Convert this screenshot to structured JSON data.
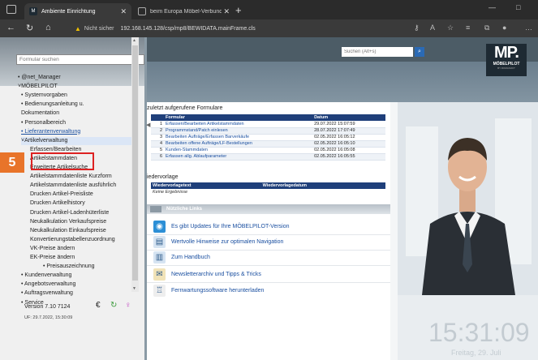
{
  "browser": {
    "tabs": [
      {
        "title": "Ambiente Einrichtung",
        "active": true
      },
      {
        "title": "beim Europa Möbel-Verbund - ",
        "active": false
      }
    ],
    "address": {
      "security_label": "Nicht sicher",
      "url": "192.168.145.128/csp/mp8/BEWIDATA.mainFrame.cls"
    }
  },
  "sidebar": {
    "search_placeholder": "Formular suchen",
    "tree": [
      {
        "label": "• @net_Manager",
        "indent": 0
      },
      {
        "label": "˅MÖBELPILOT",
        "indent": 0
      },
      {
        "label": "• Systemvorgaben",
        "indent": 1
      },
      {
        "label": "• Bedienungsanleitung u.",
        "indent": 1
      },
      {
        "label": "Dokumentation",
        "indent": 1
      },
      {
        "label": "• Personalbereich",
        "indent": 1
      },
      {
        "label": "• Lieferantenverwaltung",
        "indent": 1,
        "link": true
      },
      {
        "label": "˅Artikelverwaltung",
        "indent": 1,
        "highlight": true
      },
      {
        "label": "Erfassen/Bearbeiten",
        "indent": 2
      },
      {
        "label": "Artikelstammdaten",
        "indent": 2
      },
      {
        "label": "Erweiterte Artikelsuche",
        "indent": 2
      },
      {
        "label": "Artikelstammdatenliste Kurzform",
        "indent": 2
      },
      {
        "label": "Artikelstammdatenliste ausführlich",
        "indent": 2
      },
      {
        "label": "Drucken Artikel-Preisliste",
        "indent": 2
      },
      {
        "label": "Drucken Artikelhistory",
        "indent": 2
      },
      {
        "label": "Drucken Artikel-Ladenhüterliste",
        "indent": 2
      },
      {
        "label": "Neukalkulation Verkaufspreise",
        "indent": 2
      },
      {
        "label": "Neukalkulation Einkaufspreise",
        "indent": 2
      },
      {
        "label": "Konvertierungstabellenzuordnung",
        "indent": 2
      },
      {
        "label": "VK-Preise ändern",
        "indent": 2
      },
      {
        "label": "EK-Preise ändern",
        "indent": 2
      },
      {
        "label": "• Preisauszeichnung",
        "indent": 3
      },
      {
        "label": "• Kundenverwaltung",
        "indent": 1
      },
      {
        "label": "• Angebotsverwaltung",
        "indent": 1
      },
      {
        "label": "• Auftragsverwaltung",
        "indent": 1
      },
      {
        "label": "• Service",
        "indent": 1
      }
    ],
    "version": "Version 7.10 7124",
    "uf_timestamp": "UF: 29.7.2022, 15:30:09"
  },
  "annotation": {
    "step_number": "5"
  },
  "header": {
    "search_placeholder": "Suchen (Alt+s)",
    "logo_text": "MP.",
    "logo_name": "MÖBELPILOT",
    "logo_sub": "BY ROMASOFT"
  },
  "recent": {
    "title": "zuletzt aufgerufene Formulare",
    "columns": [
      "Formular",
      "Datum"
    ],
    "rows": [
      {
        "num": "1",
        "formular": "Erfassen/Bearbeiten Artikelstammdaten",
        "datum": "29.07.2022 15:07:59"
      },
      {
        "num": "2",
        "formular": "Programmstand/Patch einlesen",
        "datum": "28.07.2022 17:07:49"
      },
      {
        "num": "3",
        "formular": "Bearbeiten Aufträge/Erfassen Barverkäufe",
        "datum": "02.05.2022 16:05:12"
      },
      {
        "num": "4",
        "formular": "Bearbeiten offene Aufträge/LF-Bestellungen",
        "datum": "02.05.2022 16:05:10"
      },
      {
        "num": "5",
        "formular": "Kunden-Stammdaten",
        "datum": "02.05.2022 16:05:08"
      },
      {
        "num": "6",
        "formular": "Erfassen allg. Ablaufparameter",
        "datum": "02.05.2022 16:05:55"
      }
    ]
  },
  "wiedervorlage": {
    "title": "iedervorlage",
    "columns": [
      "Wiedervorlagetext",
      "Wiedervorlagedatum"
    ],
    "empty_text": "Keine Ergebnisse"
  },
  "links": {
    "title": "Nützliche Links",
    "items": [
      {
        "label": "Es gibt Updates für Ihre MÖBELPILOT-Version",
        "icon": "globe-icon"
      },
      {
        "label": "Wertvolle Hinweise zur optimalen Navigation",
        "icon": "book-icon"
      },
      {
        "label": "Zum Handbuch",
        "icon": "manual-icon"
      },
      {
        "label": "Newsletterarchiv und Tipps & Tricks",
        "icon": "newsletter-icon"
      },
      {
        "label": "Fernwartungssoftware herunterladen",
        "icon": "remote-icon"
      }
    ]
  },
  "clock": {
    "time": "15:31:09",
    "date": "Freitag, 29. Juli"
  },
  "colors": {
    "accent": "#1f3f7a",
    "step_badge": "#e8742a",
    "highlight_border": "#dd2222"
  }
}
